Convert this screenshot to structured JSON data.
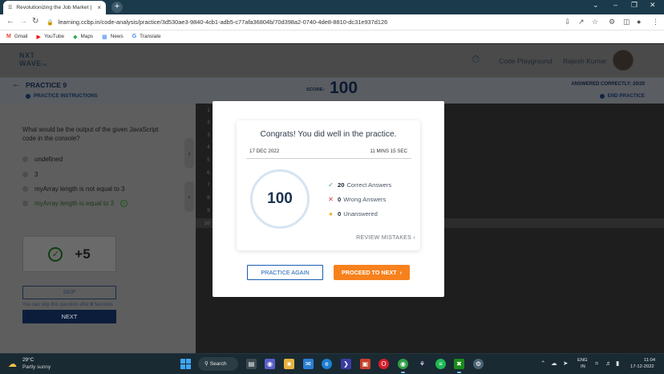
{
  "browser": {
    "tab_title": "Revolutionizing the Job Market |",
    "tab_favicon": "nxtwave-favicon",
    "new_tab": "+",
    "url": "learning.ccbp.in/code-analysis/practice/3d530ae3-9840-4cb1-adb5-c77afa36804b/70d398a2-0740-4de8-8810-dc31e937d126",
    "bookmarks": [
      {
        "icon": "gmail-icon",
        "label": "Gmail",
        "color": "#ea4335"
      },
      {
        "icon": "youtube-icon",
        "label": "YouTube",
        "color": "#ff0000"
      },
      {
        "icon": "maps-icon",
        "label": "Maps",
        "color": "#34a853"
      },
      {
        "icon": "news-icon",
        "label": "News",
        "color": "#4285f4"
      },
      {
        "icon": "translate-icon",
        "label": "Translate",
        "color": "#4285f4"
      }
    ]
  },
  "header": {
    "logo_line1": "NXT",
    "logo_line2": "WAVE",
    "logo_tm": "TM",
    "code_playground": "Code Playground",
    "user_name": "Rajesh Kumar"
  },
  "practice": {
    "title": "PRACTICE 9",
    "instructions": "PRACTICE INSTRUCTIONS",
    "score_label": "SCORE:",
    "score_value": "100",
    "answered": "ANSWERED CORRECTLY: 20/20",
    "end_practice": "END PRACTICE"
  },
  "question": {
    "text": "What would be the output of the given JavaScript code in the console?",
    "options": [
      {
        "label": "undefined",
        "correct": false
      },
      {
        "label": "3",
        "correct": false
      },
      {
        "label": "myArray length is not equal to 3",
        "correct": false
      },
      {
        "label": "myArray length is equal to 3",
        "correct": true
      }
    ],
    "points": "+5",
    "skip_label": "SKIP",
    "skip_note_prefix": "You can skip this question after ",
    "skip_note_seconds": "8",
    "skip_note_suffix": " Seconds",
    "next_label": "NEXT"
  },
  "editor": {
    "line_numbers": [
      "1",
      "2",
      "3",
      "4",
      "5",
      "6",
      "7",
      "8",
      "9",
      "10"
    ]
  },
  "modal": {
    "congrats": "Congrats! You did well in the practice.",
    "date": "17 DEC 2022",
    "duration": "11 MINS 15 SEC",
    "score": "100",
    "stats": [
      {
        "icon": "check-icon",
        "count": "20",
        "label": "Correct Answers",
        "color": "#2e9b4f"
      },
      {
        "icon": "cross-icon",
        "count": "0",
        "label": "Wrong Answers",
        "color": "#d8373a"
      },
      {
        "icon": "dot-icon",
        "count": "0",
        "label": "Unanswered",
        "color": "#f2b21b"
      }
    ],
    "review": "REVIEW MISTAKES",
    "practice_again": "PRACTICE AGAIN",
    "proceed": "PROCEED TO NEXT"
  },
  "taskbar": {
    "temp": "29°C",
    "weather": "Partly sunny",
    "search": "Search",
    "lang1": "ENG",
    "lang2": "IN",
    "time": "11:04",
    "date": "17-12-2022"
  }
}
